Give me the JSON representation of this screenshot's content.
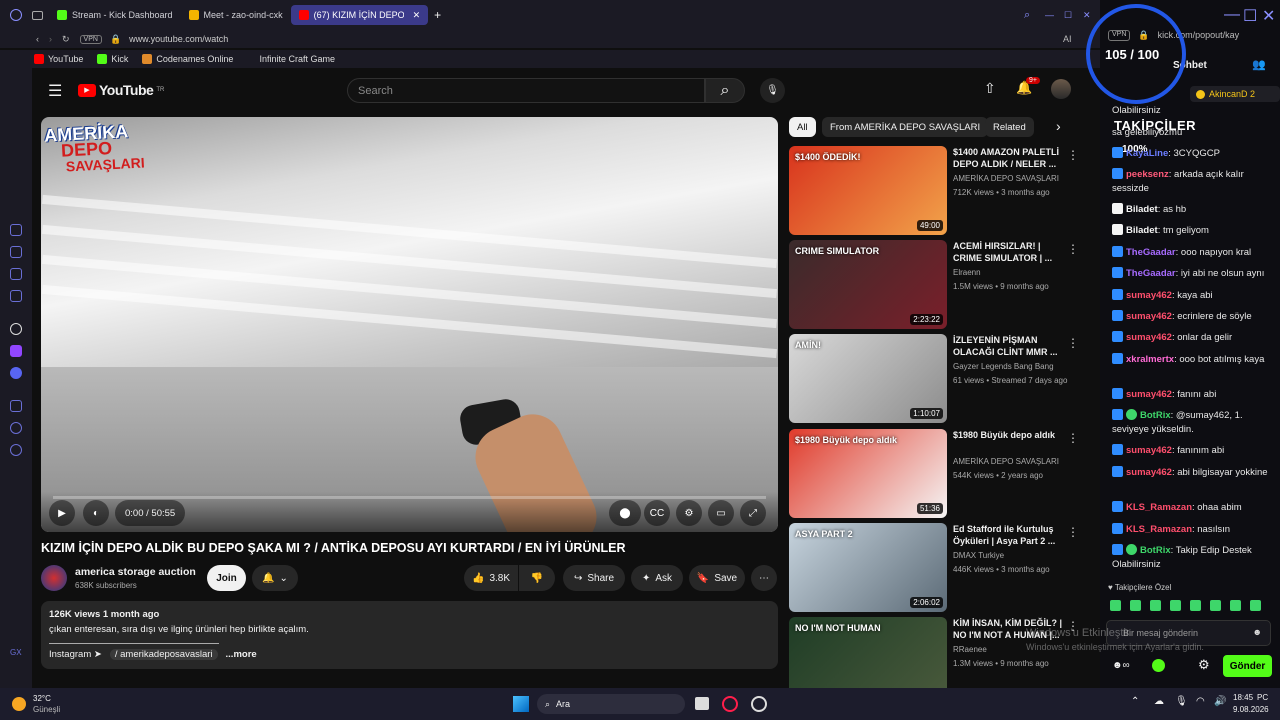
{
  "tabs": [
    {
      "label": "Stream - Kick Dashboard",
      "color": "#53fc18"
    },
    {
      "label": "Meet - zao-oind-cxk",
      "color": "#f4b400"
    },
    {
      "label": "(67) KIZIM İÇİN DEPO",
      "color": "#ff0000"
    }
  ],
  "address": {
    "vpn": "VPN",
    "url": "www.youtube.com/watch",
    "ai": "AI",
    "url2": "kick.com/popout/kay"
  },
  "bookmarks": [
    "YouTube",
    "Kick",
    "Codenames Online",
    "Infinite Craft Game"
  ],
  "yt": {
    "logo": "YouTube",
    "region": "TR",
    "search_placeholder": "Search",
    "notif_count": "9+",
    "overlay_line1": "AMERİKA",
    "overlay_line2": "DEPO",
    "overlay_line3": "SAVAŞLARI",
    "time": "0:00 / 50:55",
    "title": "KIZIM İÇİN DEPO ALDİK BU DEPO ŞAKA MI ? / ANTİKA DEPOSU AYI KURTARDI / EN İYİ ÜRÜNLER",
    "channel": "america storage auction",
    "subs": "638K subscribers",
    "join": "Join",
    "likes": "3.8K",
    "share": "Share",
    "ask": "Ask",
    "save": "Save",
    "desc_meta": "126K views  1 month ago",
    "desc_text": "çıkan enteresan, sıra dışı ve ilginç ürünleri hep birlikte açalım.",
    "desc_link_label": "Instagram ➤",
    "desc_link": "/ amerikadeposavaslari",
    "more": "...more"
  },
  "chips": [
    "All",
    "From AMERİKA DEPO SAVAŞLARI",
    "Related"
  ],
  "related": [
    {
      "title": "$1400 AMAZON PALETLİ DEPO ALDIK / NELER ...",
      "channel": "AMERİKA DEPO SAVAŞLARI",
      "meta": "712K views • 3 months ago",
      "duration": "49:00",
      "colors": [
        "#d8331d",
        "#f2a34a"
      ],
      "caption": "$1400 ÖDEDİK!"
    },
    {
      "title": "ACEMİ HIRSIZLAR! | CRIME SIMULATOR | ...",
      "channel": "Elraenn",
      "meta": "1.5M views • 9 months ago",
      "duration": "2:23:22",
      "colors": [
        "#3a2b2b",
        "#7a1f2a"
      ],
      "caption": "CRIME SIMULATOR"
    },
    {
      "title": "İZLEYENİN PİŞMAN OLACAĞI CLİNT MMR ...",
      "channel": "Gayzer Legends Bang Bang",
      "meta": "61 views • Streamed 7 days ago",
      "duration": "1:10:07",
      "colors": [
        "#d9d9d9",
        "#8c8c8c"
      ],
      "caption": "AMİN!"
    },
    {
      "title": "$1980 Büyük depo aldık",
      "channel": "AMERİKA DEPO SAVAŞLARI",
      "meta": "544K views • 2 years ago",
      "duration": "51:36",
      "colors": [
        "#e03a2a",
        "#f5f5f5"
      ],
      "caption": "$1980 Büyük depo aldık"
    },
    {
      "title": "Ed Stafford ile Kurtuluş Öyküleri | Asya Part 2 ...",
      "channel": "DMAX Turkiye",
      "meta": "446K views • 3 months ago",
      "duration": "2:06:02",
      "colors": [
        "#c7d4de",
        "#5c6b77"
      ],
      "caption": "ASYA PART 2"
    },
    {
      "title": "KİM İNSAN, KİM DEĞİL? | NO I'M NOT A HUMAN |...",
      "channel": "RRaenee",
      "meta": "1.3M views • 9 months ago",
      "duration": "",
      "colors": [
        "#1f3d26",
        "#4a5a3c"
      ],
      "caption": "NO I'M NOT HUMAN"
    }
  ],
  "chat": {
    "header": "Sohbet",
    "top_user": "AkincanD 2",
    "counter": "105 / 100",
    "followers": "TAKİPÇİLER",
    "percent": "100%",
    "messages": [
      {
        "user": "",
        "text": "Olabilirsiniz",
        "color": "#e8e8e8"
      },
      {
        "user": "",
        "text": "sa gelebiliyozmu",
        "color": "#e8e8e8"
      },
      {
        "user": "KayaLine",
        "text": ": 3CYQGCP",
        "color": "#6b7dff"
      },
      {
        "user": "peeksenz",
        "text": ": arkada açık kalır sessizde",
        "color": "#ff5a7a"
      },
      {
        "user": "Biladet",
        "text": ": as hb",
        "color": "#f5f5f5"
      },
      {
        "user": "Biladet",
        "text": ": tm geliyom",
        "color": "#f5f5f5"
      },
      {
        "user": "TheGaadar",
        "text": ": ooo napıyon kral",
        "color": "#a76bff"
      },
      {
        "user": "TheGaadar",
        "text": ": iyi abi ne olsun aynı",
        "color": "#a76bff"
      },
      {
        "user": "sumay462",
        "text": ": kaya abi",
        "color": "#ff4f6d"
      },
      {
        "user": "sumay462",
        "text": ": ecrinlere de söyle",
        "color": "#ff4f6d"
      },
      {
        "user": "sumay462",
        "text": ": onlar da gelir",
        "color": "#ff4f6d"
      },
      {
        "user": "xkralmertx",
        "text": ": ooo bot atılmış kaya",
        "color": "#ff6bd5"
      },
      {
        "user": "sumay462",
        "text": ": fanını abi",
        "color": "#ff4f6d"
      },
      {
        "user": "BotRix",
        "text": ": @sumay462, 1. seviyeye yükseldin.",
        "color": "#3ed66a"
      },
      {
        "user": "sumay462",
        "text": ": fanınım abi",
        "color": "#ff4f6d"
      },
      {
        "user": "sumay462",
        "text": ": abi bilgisayar yokkine",
        "color": "#ff4f6d"
      },
      {
        "user": "KLS_Ramazan",
        "text": ": ohaa abim",
        "color": "#ff4f6d"
      },
      {
        "user": "KLS_Ramazan",
        "text": ": nasılsın",
        "color": "#ff4f6d"
      },
      {
        "user": "BotRix",
        "text": ": Takip Edip Destek Olabilirsiniz",
        "color": "#3ed66a"
      }
    ],
    "special": "Takipçilere Özel",
    "input_placeholder": "Bir mesaj gönderin",
    "send": "Gönder",
    "watermark1": "Windows'u Etkinleştir",
    "watermark2": "Windows'u etkinleştirmek için Ayarlar'a gidin."
  },
  "taskbar": {
    "weather_temp": "32°C",
    "weather_text": "Güneşli",
    "search": "Ara",
    "time": "18:45",
    "lang": "PC",
    "date": "9.08.2026"
  }
}
